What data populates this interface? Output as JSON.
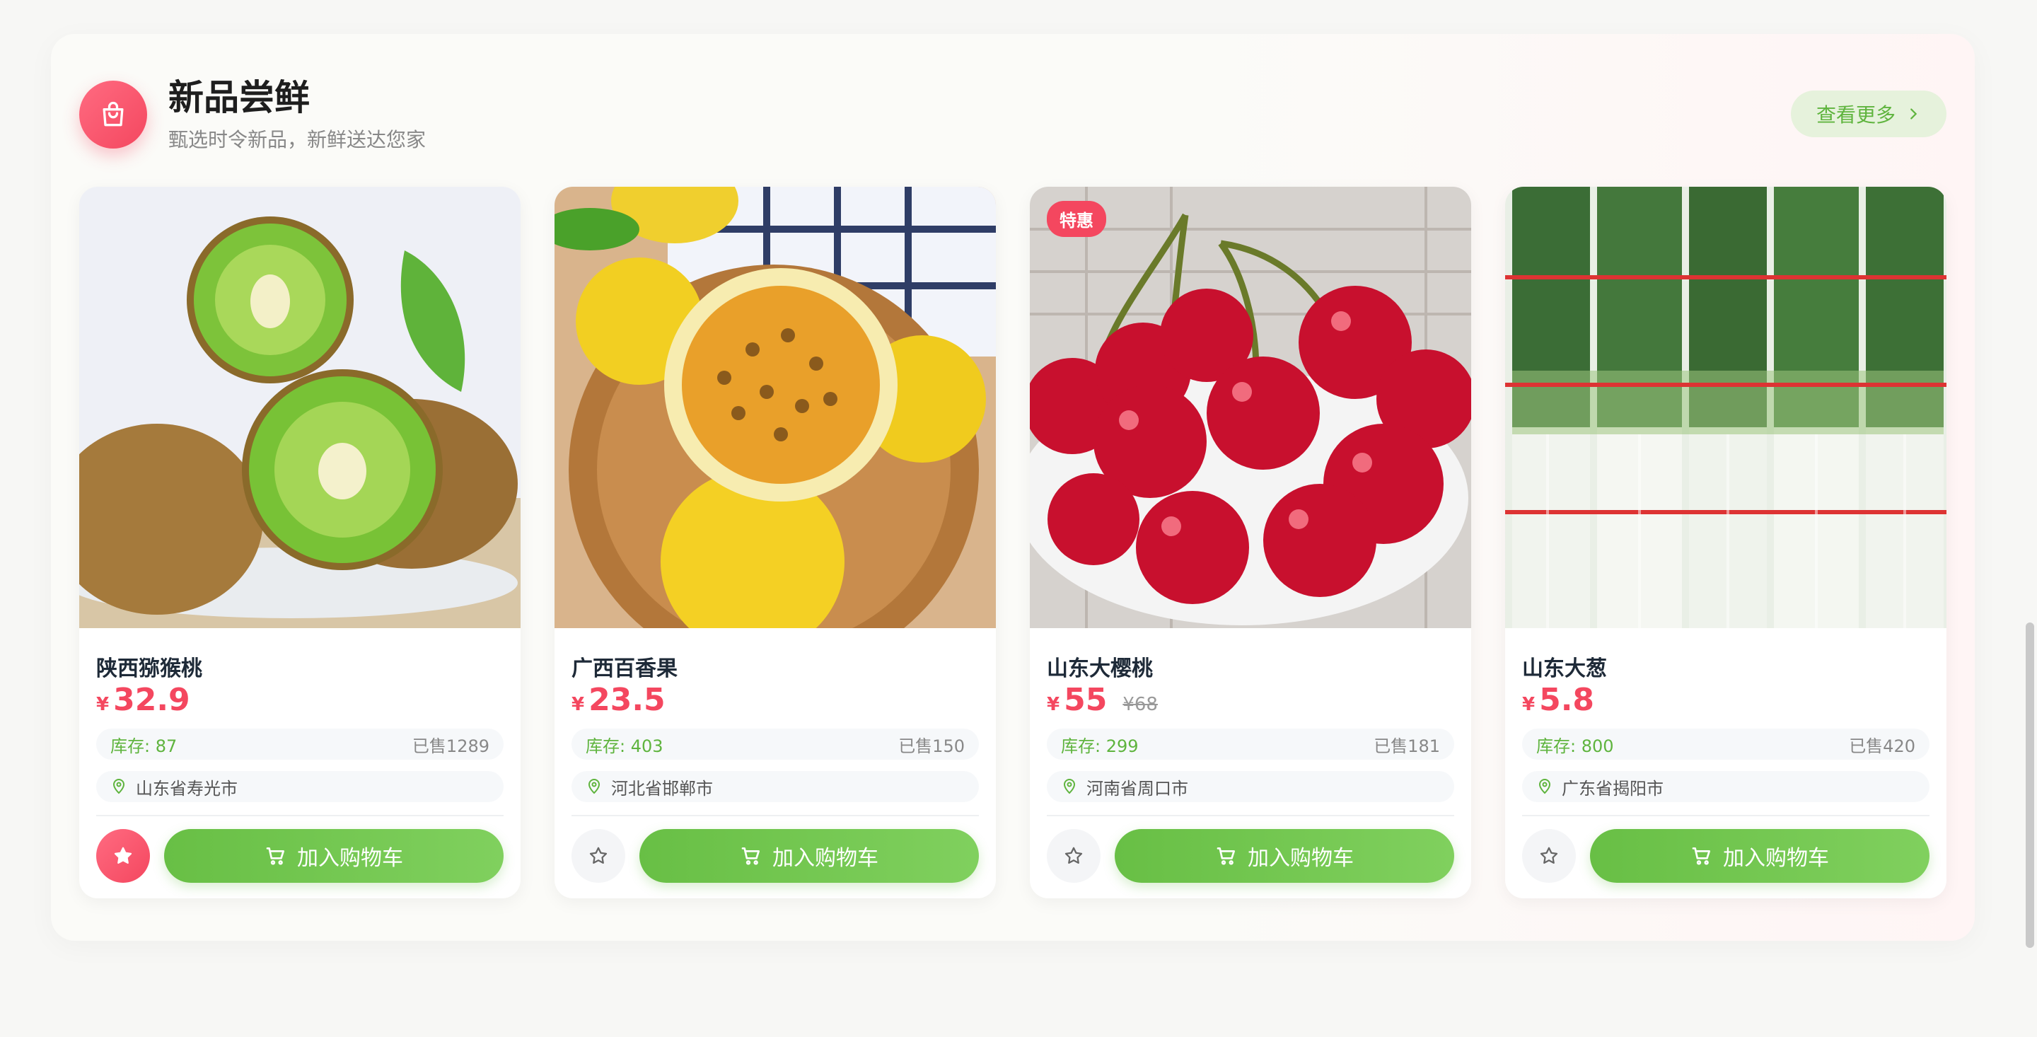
{
  "section": {
    "title": "新品尝鲜",
    "subtitle": "甄选时令新品，新鲜送达您家",
    "more_label": "查看更多"
  },
  "products": [
    {
      "name": "陕西猕猴桃",
      "currency": "¥",
      "price": "32.9",
      "original_price": "",
      "badge": "",
      "stock": "库存: 87",
      "sold": "已售1289",
      "location": "山东省寿光市",
      "favorited": true,
      "cart_label": "加入购物车"
    },
    {
      "name": "广西百香果",
      "currency": "¥",
      "price": "23.5",
      "original_price": "",
      "badge": "",
      "stock": "库存: 403",
      "sold": "已售150",
      "location": "河北省邯郸市",
      "favorited": false,
      "cart_label": "加入购物车"
    },
    {
      "name": "山东大樱桃",
      "currency": "¥",
      "price": "55",
      "original_price": "¥68",
      "badge": "特惠",
      "stock": "库存: 299",
      "sold": "已售181",
      "location": "河南省周口市",
      "favorited": false,
      "cart_label": "加入购物车"
    },
    {
      "name": "山东大葱",
      "currency": "¥",
      "price": "5.8",
      "original_price": "",
      "badge": "",
      "stock": "库存: 800",
      "sold": "已售420",
      "location": "广东省揭阳市",
      "favorited": false,
      "cart_label": "加入购物车"
    }
  ],
  "colors": {
    "accent_red": "#f4475f",
    "accent_green": "#68bf45"
  },
  "icons": {
    "header": "shopping-bag-icon",
    "more": "chevron-right-icon",
    "location": "location-pin-icon",
    "favorite": "star-icon",
    "cart": "cart-icon"
  }
}
